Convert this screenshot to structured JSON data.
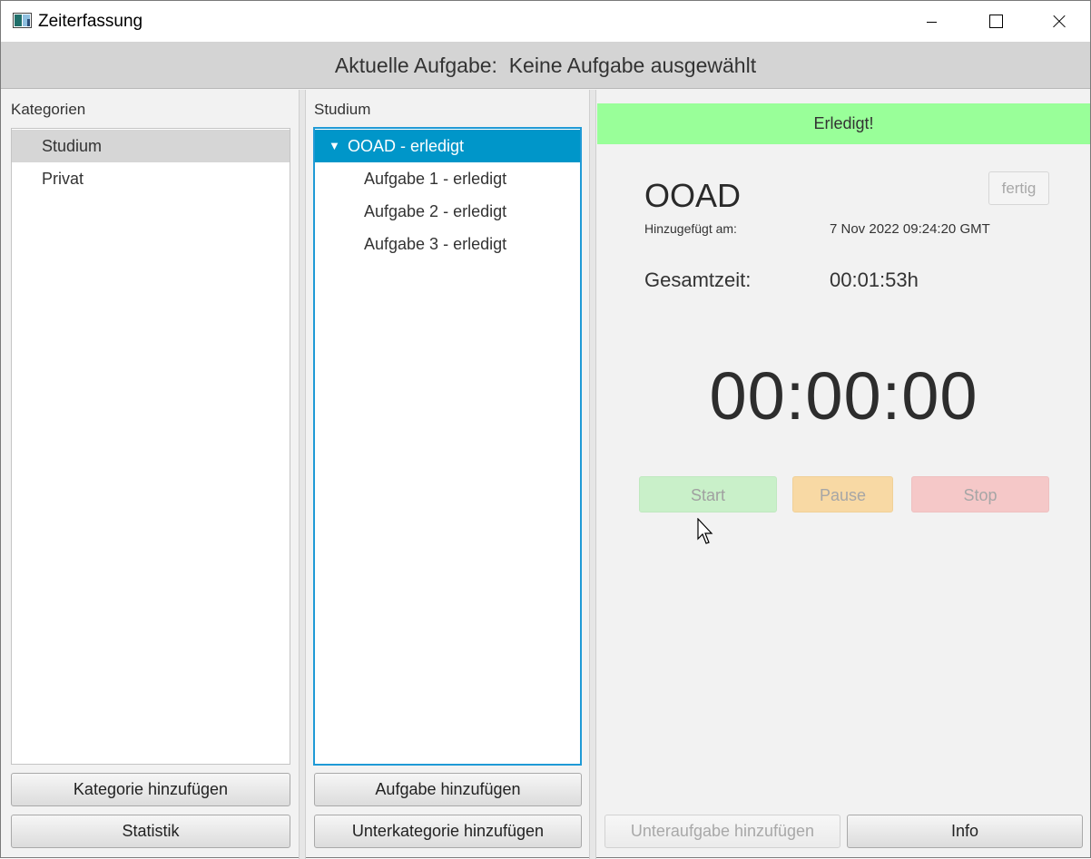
{
  "window": {
    "title": "Zeiterfassung"
  },
  "header": {
    "label": "Aktuelle Aufgabe:",
    "value": "Keine Aufgabe ausgewählt"
  },
  "categories": {
    "label": "Kategorien",
    "items": [
      {
        "label": "Studium",
        "selected": true
      },
      {
        "label": "Privat",
        "selected": false
      }
    ],
    "add_button": "Kategorie hinzufügen",
    "stats_button": "Statistik"
  },
  "tasks": {
    "label": "Studium",
    "tree": {
      "root": "OOAD - erledigt",
      "children": [
        "Aufgabe 1 - erledigt",
        "Aufgabe 2 - erledigt",
        "Aufgabe 3 - erledigt"
      ]
    },
    "add_button": "Aufgabe hinzufügen",
    "add_sub_button": "Unterkategorie hinzufügen"
  },
  "detail": {
    "status_banner": "Erledigt!",
    "title": "OOAD",
    "done_button": "fertig",
    "added_label": "Hinzugefügt am:",
    "added_value": "7 Nov 2022 09:24:20 GMT",
    "total_label": "Gesamtzeit:",
    "total_value": "00:01:53h",
    "timer": "00:00:00",
    "start_button": "Start",
    "pause_button": "Pause",
    "stop_button": "Stop",
    "add_subtask_button": "Unteraufgabe hinzufügen",
    "info_button": "Info"
  },
  "colors": {
    "banner": "#99ff99",
    "tree_selected": "#0096c9",
    "start": "#c9f0c9",
    "pause": "#f8d9a4",
    "stop": "#f5c8c8"
  }
}
